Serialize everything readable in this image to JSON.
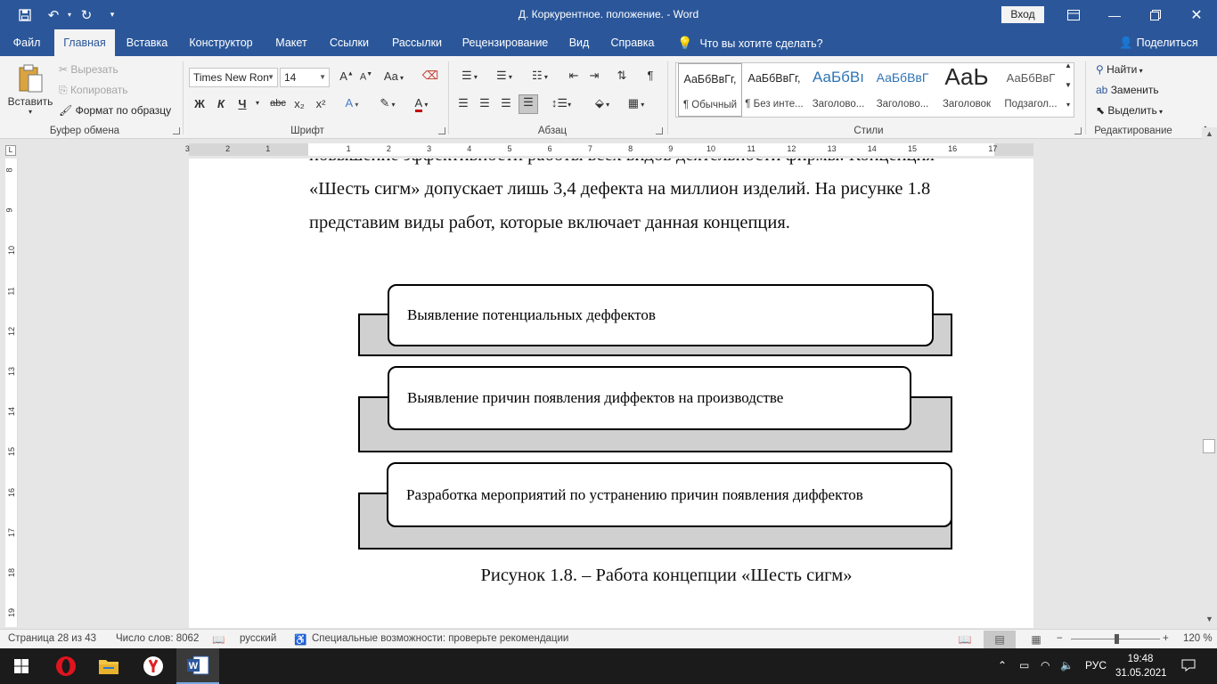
{
  "window": {
    "title": "Д. Коркурентное. положение.  -  Word",
    "sign_in": "Вход"
  },
  "tabs": [
    {
      "label": "Файл"
    },
    {
      "label": "Главная"
    },
    {
      "label": "Вставка"
    },
    {
      "label": "Конструктор"
    },
    {
      "label": "Макет"
    },
    {
      "label": "Ссылки"
    },
    {
      "label": "Рассылки"
    },
    {
      "label": "Рецензирование"
    },
    {
      "label": "Вид"
    },
    {
      "label": "Справка"
    }
  ],
  "tell_me": "Что вы хотите сделать?",
  "share": "Поделиться",
  "clipboard": {
    "paste": "Вставить",
    "cut": "Вырезать",
    "copy": "Копировать",
    "format_painter": "Формат по образцу",
    "group": "Буфер обмена"
  },
  "font": {
    "name": "Times New Ron",
    "size": "14",
    "group": "Шрифт",
    "bold": "Ж",
    "italic": "К",
    "underline": "Ч",
    "strike": "abc",
    "subscript": "x₂",
    "superscript": "x²",
    "change_case": "Aa"
  },
  "paragraph": {
    "group": "Абзац"
  },
  "styles": {
    "group": "Стили",
    "items": [
      {
        "preview": "АаБбВвГг,",
        "name": "¶ Обычный"
      },
      {
        "preview": "АаБбВвГг,",
        "name": "¶ Без инте..."
      },
      {
        "preview": "АаБбВı",
        "name": "Заголово..."
      },
      {
        "preview": "АаБбВвГ",
        "name": "Заголово..."
      },
      {
        "preview": "АаЬ",
        "name": "Заголовок"
      },
      {
        "preview": "АаБбВвГ",
        "name": "Подзагол..."
      }
    ]
  },
  "editing": {
    "group": "Редактирование",
    "find": "Найти",
    "replace": "Заменить",
    "select": "Выделить"
  },
  "document": {
    "line_partial": "повышение эффективности работы всех видов деятельности фирмы. Концепция",
    "line2": "«Шесть сигм» допускает лишь 3,4 дефекта на миллион изделий. На рисунке 1.8",
    "line3": "представим виды работ, которые включает данная концепция.",
    "diagram": [
      {
        "text": "Выявление потенциальных деффектов"
      },
      {
        "text": "Выявление причин появления диффектов на производстве"
      },
      {
        "text": "Разработка мероприятий по устранению причин появления диффектов"
      }
    ],
    "caption": "Рисунок 1.8. – Работа концепции «Шесть сигм»"
  },
  "ruler": {
    "h_numbers": [
      "3",
      "2",
      "1",
      "1",
      "2",
      "3",
      "4",
      "5",
      "6",
      "7",
      "8",
      "9",
      "10",
      "11",
      "12",
      "13",
      "14",
      "15",
      "16",
      "17"
    ],
    "v_numbers": [
      "8",
      "9",
      "10",
      "11",
      "12",
      "13",
      "14",
      "15",
      "16",
      "17",
      "18",
      "19"
    ]
  },
  "status": {
    "page": "Страница 28 из 43",
    "words": "Число слов: 8062",
    "language": "русский",
    "accessibility": "Специальные возможности: проверьте рекомендации",
    "zoom": "120 %"
  },
  "taskbar": {
    "lang": "РУС",
    "time": "19:48",
    "date": "31.05.2021"
  }
}
